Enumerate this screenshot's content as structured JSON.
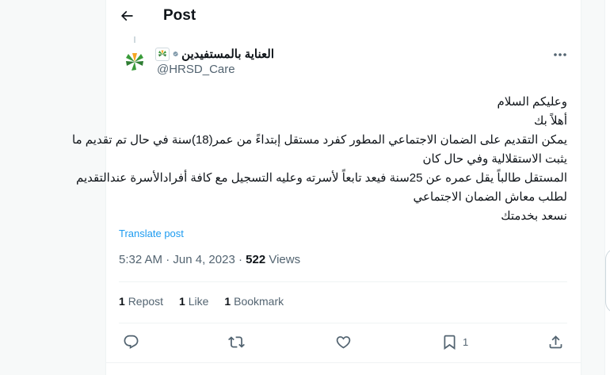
{
  "header": {
    "title": "Post"
  },
  "author": {
    "display_name": "العناية بالمستفيدين",
    "handle": "@HRSD_Care"
  },
  "tweet": {
    "lines": [
      "وعليكم السلام",
      "أهلاً بك",
      "يمكن التقديم على الضمان الاجتماعي المطور كفرد مستقل إبتداءً من عمر(18)سنة في حال تم تقديم ما",
      "يثبت الاستقلالية وفي حال كان",
      "المستقل طالباً يقل عمره عن 25سنة فيعد تابعاً لأسرته وعليه التسجيل مع كافة أفرادالأسرة عندالتقديم",
      "لطلب معاش الضمان الاجتماعي",
      "نسعد بخدمتك"
    ]
  },
  "translate_label": "Translate post",
  "meta": {
    "time": "5:32 AM",
    "sep1": " · ",
    "date": "Jun 4, 2023",
    "sep2": " · ",
    "views_count": "522",
    "views_label": " Views"
  },
  "stats": {
    "repost_count": "1",
    "repost_label": "Repost",
    "like_count": "1",
    "like_label": "Like",
    "bookmark_count": "1",
    "bookmark_label": "Bookmark"
  },
  "actions": {
    "bookmark_count": "1"
  },
  "icons": {
    "back": "arrow-left-icon",
    "verified": "verified-badge-icon",
    "affiliate": "affiliate-logo-icon",
    "more": "more-icon",
    "reply": "reply-icon",
    "repost": "repost-icon",
    "like": "heart-icon",
    "bookmark": "bookmark-icon",
    "share": "share-icon"
  },
  "colors": {
    "accent": "#1d9bf0",
    "secondary_text": "#536471",
    "primary_text": "#0f1419",
    "logo_green": "#3a9b3a",
    "logo_yellow": "#f5a623"
  }
}
